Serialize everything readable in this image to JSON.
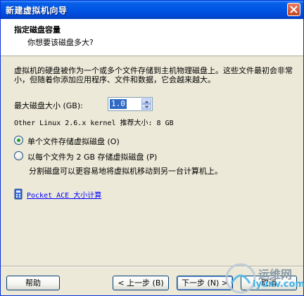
{
  "window": {
    "title": "新建虚拟机向导"
  },
  "header": {
    "title": "指定磁盘容量",
    "subtitle": "你想要该磁盘多大?"
  },
  "body": {
    "description": "虚拟机的硬盘被作为一个或多个文件存储到主机物理磁盘上。这些文件最初会非常小，但随着你添加应用程序、文件和数据，它会越来越大。",
    "max_size_label": "最大磁盘大小 (GB):",
    "max_size_value": "1.0",
    "recommended": "Other Linux 2.6.x kernel 推荐大小: 8 GB",
    "radio_single": {
      "label": "单个文件存储虚拟磁盘 (O)",
      "checked": true
    },
    "radio_split": {
      "label": "以每个文件为 2 GB 存储虚拟磁盘 (P)",
      "checked": false
    },
    "split_note": "分割磁盘可以更容易地将虚拟机移动到另一台计算机上。",
    "calculator_link": "Pocket ACE 大小计算"
  },
  "buttons": {
    "help": "帮助",
    "back": "< 上一步 (B)",
    "next": "下一步 (N) >",
    "cancel": "取消"
  },
  "watermark": {
    "line1": "运维网",
    "line2": "iyunv.com"
  },
  "colors": {
    "titlebar": "#0055e5",
    "selection": "#316ac5",
    "link": "#0000ff",
    "radio_dot": "#21a121"
  }
}
